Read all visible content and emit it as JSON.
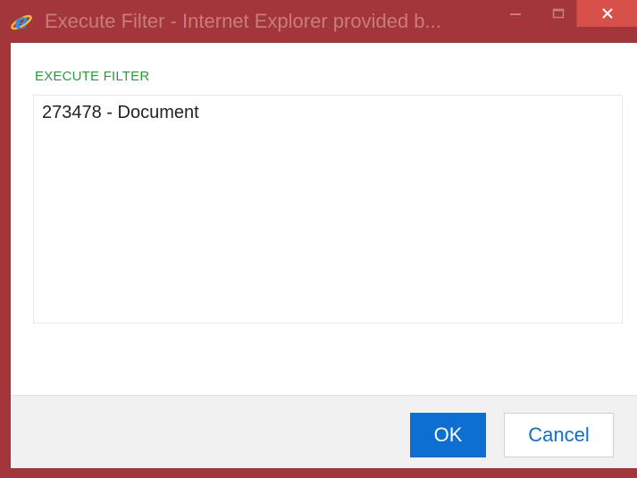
{
  "window": {
    "title": "Execute Filter - Internet Explorer provided b...",
    "frame_color": "#a3363a",
    "close_color": "#d8504a"
  },
  "icons": {
    "app": "internet-explorer-icon",
    "minimize": "minimize-icon",
    "maximize": "maximize-icon",
    "close": "close-icon"
  },
  "dialog": {
    "section_label": "EXECUTE FILTER",
    "items": [
      "273478 - Document"
    ]
  },
  "buttons": {
    "ok": "OK",
    "cancel": "Cancel"
  }
}
